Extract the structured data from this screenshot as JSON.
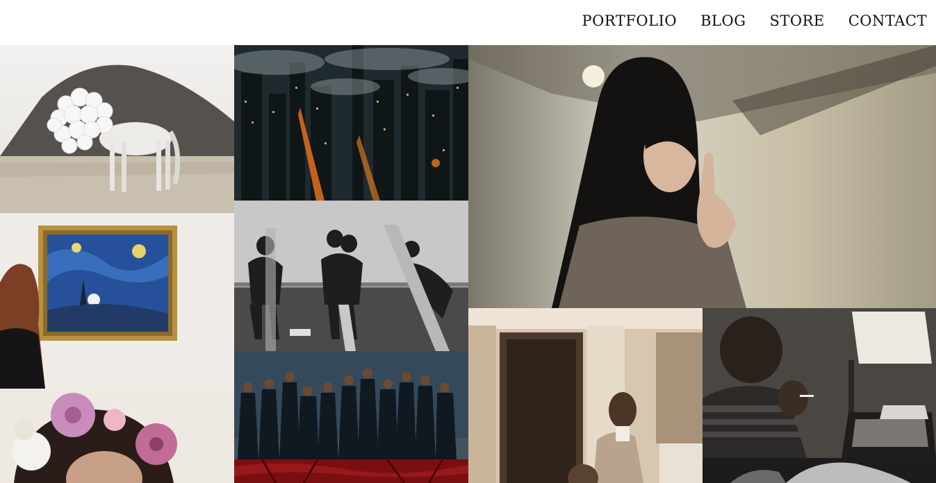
{
  "nav": {
    "items": [
      {
        "label": "PORTFOLIO"
      },
      {
        "label": "BLOG"
      },
      {
        "label": "STORE"
      },
      {
        "label": "CONTACT"
      }
    ]
  },
  "colors": {
    "background": "#ffffff",
    "nav_text": "#111111"
  },
  "gallery": {
    "tiles": [
      {
        "subject": "white horse with balloons in desert"
      },
      {
        "subject": "aerial city at night with fog"
      },
      {
        "subject": "woman viewing starry night painting"
      },
      {
        "subject": "black and white couples on seesaws"
      },
      {
        "subject": "woman in hallway with finger raised"
      },
      {
        "subject": "group portrait of women in dark dresses"
      },
      {
        "subject": "flower crown portrait"
      },
      {
        "subject": "sepia vintage man at house doorway"
      },
      {
        "subject": "man smoking beside typewriter and lamp"
      },
      {
        "subject": "red textured image"
      },
      {
        "subject": "black and white partial portrait"
      }
    ]
  }
}
